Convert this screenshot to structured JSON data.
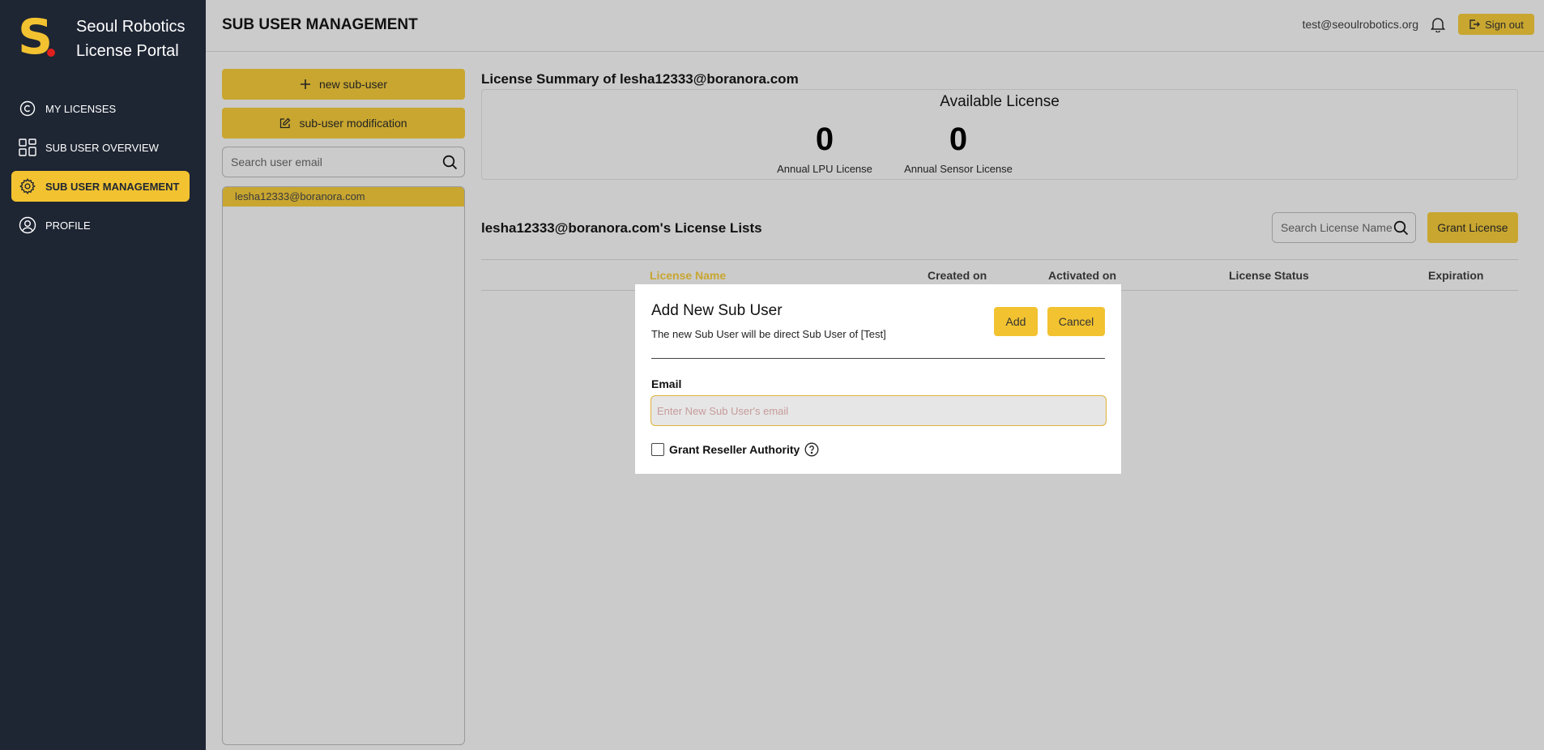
{
  "brand": {
    "logo_letter": "S",
    "line1": "Seoul Robotics",
    "line2": "License Portal"
  },
  "nav": [
    {
      "label": "MY LICENSES",
      "icon": "copyright-icon",
      "active": false
    },
    {
      "label": "SUB USER OVERVIEW",
      "icon": "grid-icon",
      "active": false
    },
    {
      "label": "SUB USER MANAGEMENT",
      "icon": "gear-icon",
      "active": true
    },
    {
      "label": "PROFILE",
      "icon": "user-circle-icon",
      "active": false
    }
  ],
  "header": {
    "title": "SUB USER MANAGEMENT",
    "user_email": "test@seoulrobotics.org",
    "signout_label": "Sign out"
  },
  "users_panel": {
    "new_button": "new sub-user",
    "modify_button": "sub-user modification",
    "search_placeholder": "Search user email",
    "users": [
      "lesha12333@boranora.com"
    ]
  },
  "summary": {
    "title": "License Summary of lesha12333@boranora.com",
    "available_title": "Available License",
    "stats": [
      {
        "value": "0",
        "label": "Annual LPU License"
      },
      {
        "value": "0",
        "label": "Annual Sensor License"
      }
    ]
  },
  "license_list": {
    "title": "lesha12333@boranora.com's License Lists",
    "search_placeholder": "Search License Name",
    "grant_button": "Grant License",
    "columns": [
      "License Name",
      "Created on",
      "Activated on",
      "License Status",
      "Expiration"
    ]
  },
  "modal": {
    "title": "Add New Sub User",
    "subtitle": "The new Sub User will be direct Sub User of [Test]",
    "add_label": "Add",
    "cancel_label": "Cancel",
    "email_label": "Email",
    "email_placeholder": "Enter New Sub User's email",
    "email_value": "",
    "reseller_label": "Grant Reseller Authority",
    "reseller_checked": false
  },
  "colors": {
    "sidebar_bg": "#1e2533",
    "accent": "#f2c230",
    "accent_dim": "#c8a630",
    "overlay_bg": "#cbcbcb"
  }
}
